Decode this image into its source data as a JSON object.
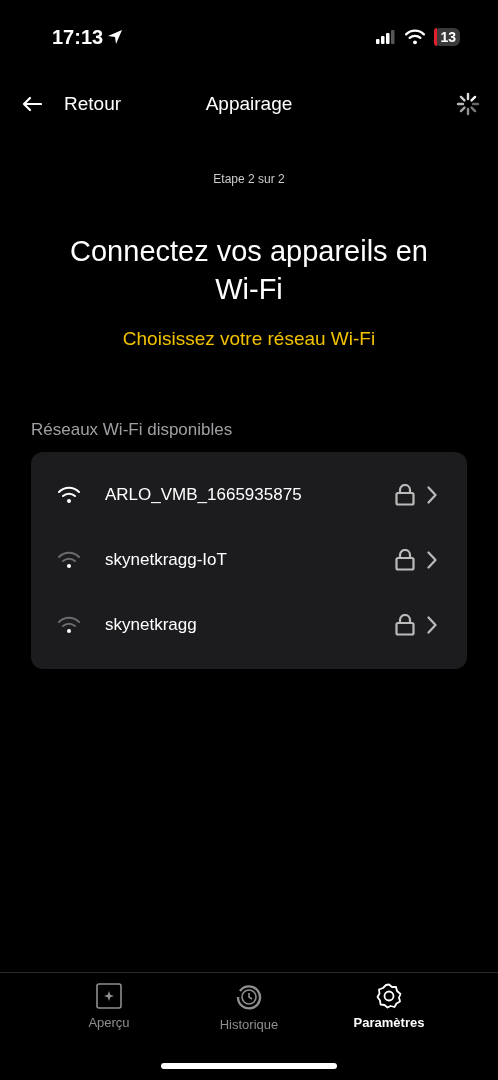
{
  "status_bar": {
    "time": "17:13",
    "battery": "13"
  },
  "nav": {
    "back": "Retour",
    "title": "Appairage"
  },
  "step": "Etape 2 sur 2",
  "heading": "Connectez vos appareils en Wi-Fi",
  "subtitle": "Choisissez votre réseau Wi-Fi",
  "section_label": "Réseaux Wi-Fi disponibles",
  "networks": [
    {
      "name": "ARLO_VMB_1665935875",
      "weak_signal": false,
      "locked": true
    },
    {
      "name": "skynetkragg-IoT",
      "weak_signal": true,
      "locked": true
    },
    {
      "name": "skynetkragg",
      "weak_signal": true,
      "locked": true
    }
  ],
  "tabs": [
    {
      "label": "Aperçu",
      "kind": "overview",
      "selected": false
    },
    {
      "label": "Historique",
      "kind": "history",
      "selected": false
    },
    {
      "label": "Paramètres",
      "kind": "settings",
      "selected": true
    }
  ]
}
